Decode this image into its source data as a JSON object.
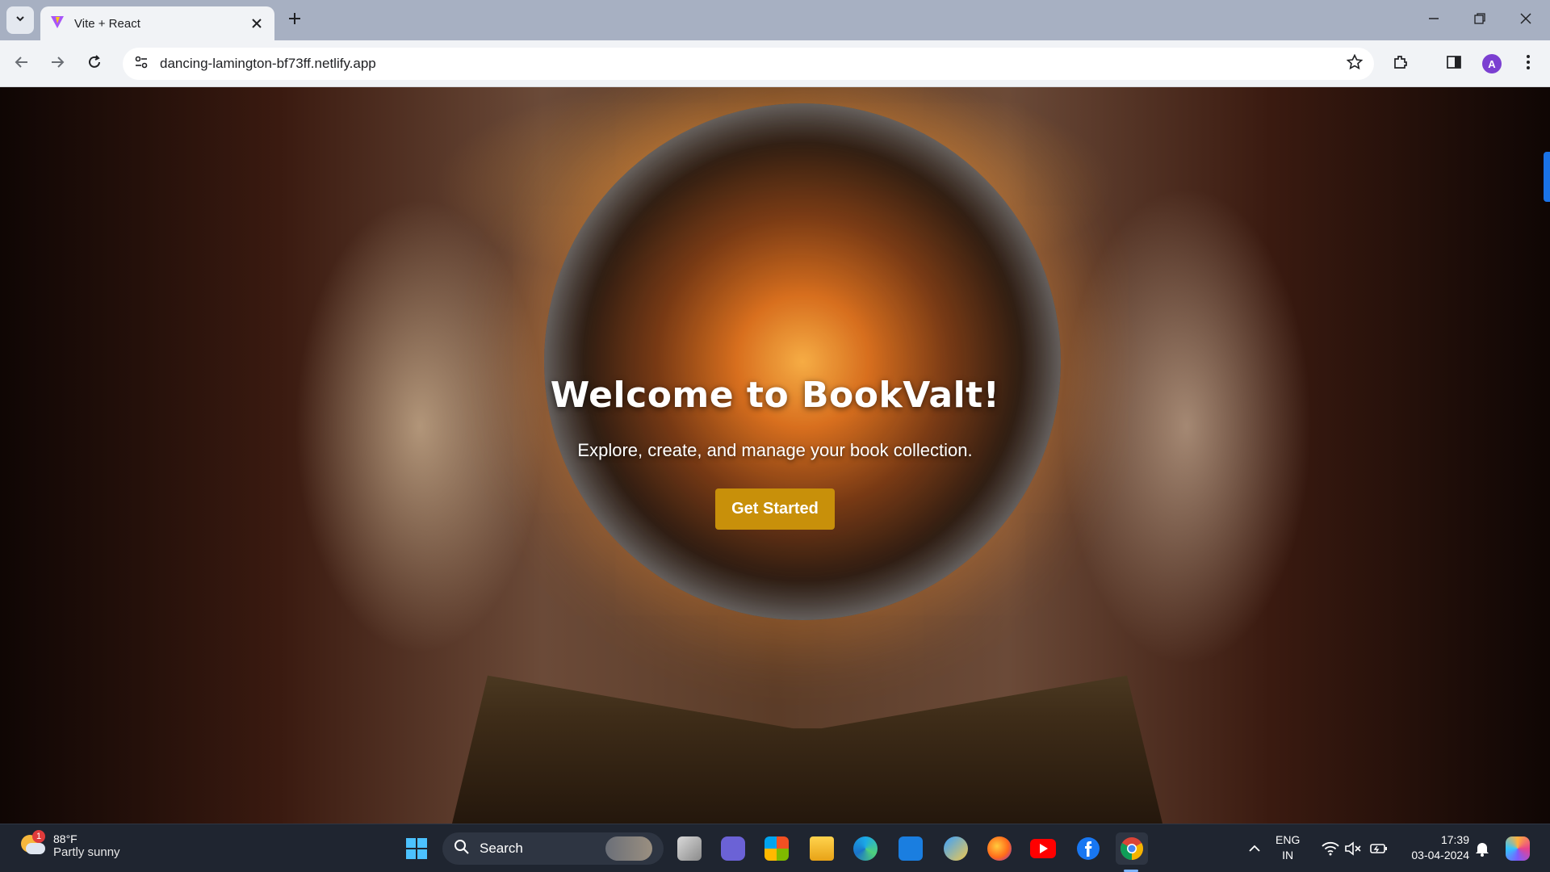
{
  "browser": {
    "tab_title": "Vite + React",
    "url": "dancing-lamington-bf73ff.netlify.app",
    "profile_initial": "A"
  },
  "hero": {
    "title": "Welcome to BookValt!",
    "subtitle": "Explore, create, and manage your book collection.",
    "cta_label": "Get Started",
    "cta_color": "#c8900a"
  },
  "taskbar": {
    "weather_temp": "88°F",
    "weather_desc": "Partly sunny",
    "weather_badge": "1",
    "search_label": "Search",
    "lang_line1": "ENG",
    "lang_line2": "IN",
    "time": "17:39",
    "date": "03-04-2024"
  },
  "icons": [
    "tab-search-icon",
    "vite-logo-icon",
    "close-icon",
    "plus-icon",
    "minimize-icon",
    "restore-icon",
    "back-icon",
    "forward-icon",
    "reload-icon",
    "site-info-icon",
    "star-icon",
    "extensions-icon",
    "sidepanel-icon",
    "menu-icon",
    "windows-start-icon",
    "search-icon",
    "task-view-icon",
    "teams-icon",
    "store-icon",
    "file-explorer-icon",
    "edge-icon",
    "myhp-icon",
    "chatgpt-icon",
    "firefox-icon",
    "youtube-icon",
    "facebook-icon",
    "chrome-icon",
    "chevron-up-icon",
    "wifi-icon",
    "mute-icon",
    "battery-icon",
    "bell-icon",
    "copilot-icon"
  ]
}
